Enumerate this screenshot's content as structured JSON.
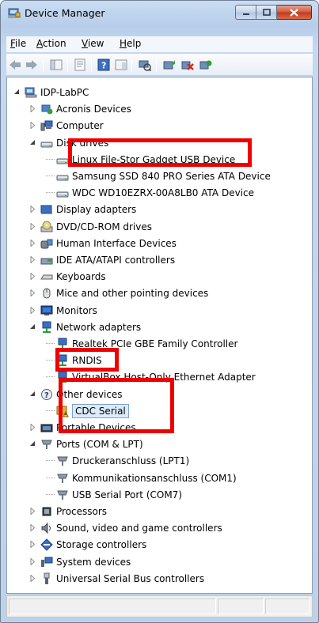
{
  "window": {
    "title": "Device Manager"
  },
  "menu": [
    {
      "label": "File",
      "accel": "F",
      "rest": "ile"
    },
    {
      "label": "Action",
      "accel": "A",
      "rest": "ction"
    },
    {
      "label": "View",
      "accel": "V",
      "rest": "iew"
    },
    {
      "label": "Help",
      "accel": "H",
      "rest": "elp"
    }
  ],
  "tree": {
    "root": "IDP-LabPC",
    "items": [
      "Acronis Devices",
      "Computer",
      "Disk drives",
      "Linux File-Stor Gadget USB Device",
      "Samsung SSD 840 PRO Series ATA Device",
      "WDC WD10EZRX-00A8LB0 ATA Device",
      "Display adapters",
      "DVD/CD-ROM drives",
      "Human Interface Devices",
      "IDE ATA/ATAPI controllers",
      "Keyboards",
      "Mice and other pointing devices",
      "Monitors",
      "Network adapters",
      "Realtek PCIe GBE Family Controller",
      "RNDIS",
      "VirtualBox Host-Only Ethernet Adapter",
      "Other devices",
      "CDC Serial",
      "Portable Devices",
      "Ports (COM & LPT)",
      "Druckeranschluss (LPT1)",
      "Kommunikationsanschluss (COM1)",
      "USB Serial Port (COM7)",
      "Processors",
      "Sound, video and game controllers",
      "Storage controllers",
      "System devices",
      "Universal Serial Bus controllers"
    ]
  },
  "colors": {
    "highlight": "#ee0000",
    "selection": "#dcebfc"
  }
}
